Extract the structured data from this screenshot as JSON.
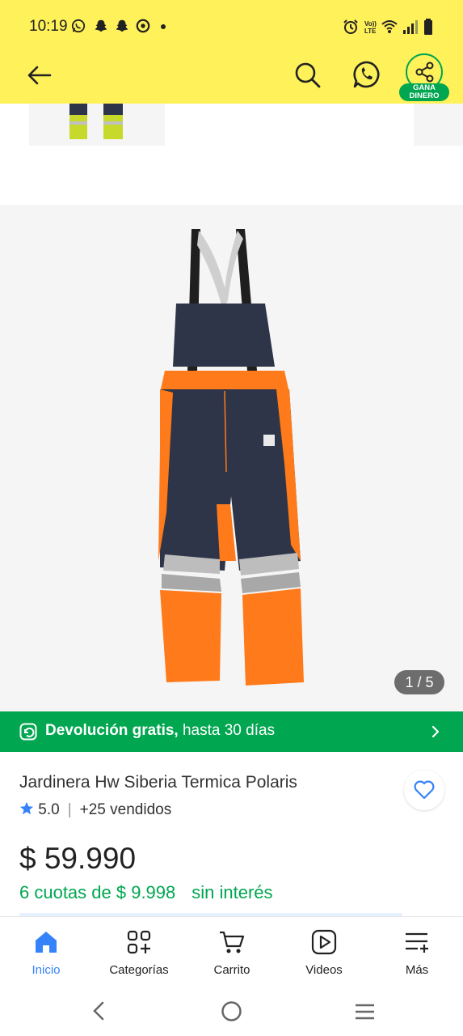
{
  "status_bar": {
    "time": "10:19",
    "notification_icons": [
      "whatsapp-icon",
      "snapchat-icon",
      "snapchat-icon",
      "chrome-icon"
    ],
    "system_icons": [
      "alarm-icon",
      "volte-icon",
      "wifi-icon",
      "signal-icon",
      "battery-icon"
    ],
    "volte_text": "Vo)) LTE"
  },
  "header": {
    "back_icon": "arrow-left-icon",
    "search_icon": "search-icon",
    "whatsapp_icon": "whatsapp-icon",
    "share_icon": "share-icon",
    "share_badge_line1": "GANA",
    "share_badge_line2": "DINERO"
  },
  "gallery": {
    "counter": "1 / 5"
  },
  "banner": {
    "bold": "Devolución gratis,",
    "rest": " hasta 30 días"
  },
  "product": {
    "title": "Jardinera Hw Siberia Termica Polaris",
    "rating": "5.0",
    "sold": "+25 vendidos",
    "price": "$ 59.990",
    "installments": "6 cuotas de $ 9.998",
    "interest": "sin interés"
  },
  "bottom_nav": {
    "items": [
      {
        "label": "Inicio",
        "icon": "home-icon"
      },
      {
        "label": "Categorías",
        "icon": "categories-icon"
      },
      {
        "label": "Carrito",
        "icon": "cart-icon"
      },
      {
        "label": "Videos",
        "icon": "video-icon"
      },
      {
        "label": "Más",
        "icon": "more-icon"
      }
    ]
  },
  "colors": {
    "header_yellow": "#fff159",
    "brand_green": "#00a650",
    "accent_blue": "#3483fa",
    "product_orange": "#ff7a1a",
    "product_navy": "#2e3548"
  }
}
